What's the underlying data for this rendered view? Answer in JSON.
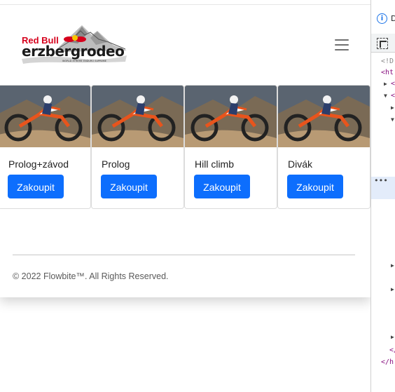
{
  "brand": {
    "sponsor": "Red Bull",
    "name": "erzbergrodeo",
    "tagline": "WORLD XTREME ENDURO SUPREME"
  },
  "cards": [
    {
      "title": "Prolog+závod",
      "button": "Zakoupit"
    },
    {
      "title": "Prolog",
      "button": "Zakoupit"
    },
    {
      "title": "Hill climb",
      "button": "Zakoupit"
    },
    {
      "title": "Divák",
      "button": "Zakoupit"
    }
  ],
  "footer": {
    "copyright": "© 2022 Flowbite™. All Rights Reserved."
  },
  "devtools": {
    "info_letter": "D",
    "lines": [
      "<!D",
      "<ht",
      "<",
      "<"
    ],
    "closing": [
      "</",
      "</h"
    ]
  },
  "colors": {
    "primary_button": "#0d6efd",
    "brand_red": "#d6001c",
    "devtools_tag": "#881280"
  }
}
